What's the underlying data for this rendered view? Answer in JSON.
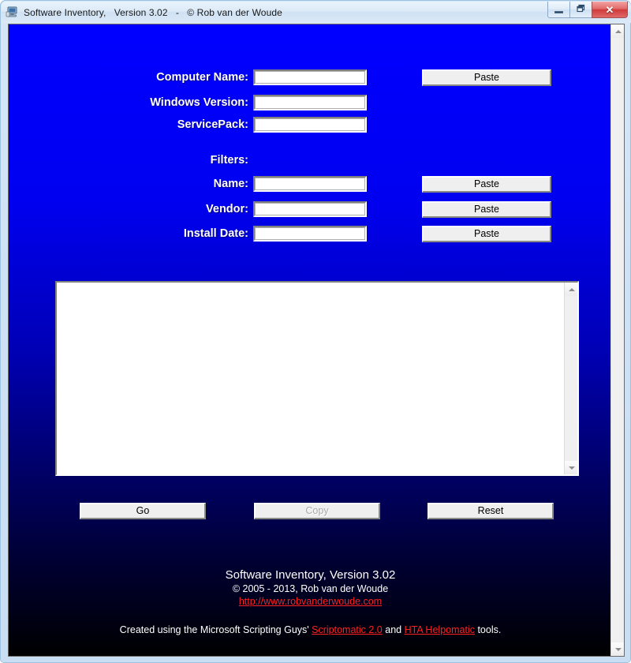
{
  "window": {
    "title": "Software Inventory,   Version 3.02   -   © Rob van der Woude",
    "icon": "computer-monitor-icon",
    "buttons": {
      "minimize": "–",
      "restore": "❐",
      "close": "✕"
    }
  },
  "form": {
    "fields": [
      {
        "label": "Computer Name:",
        "value": "",
        "paste_label": "Paste",
        "has_paste": true,
        "focused": true
      },
      {
        "label": "Windows Version:",
        "value": "",
        "paste_label": "Paste",
        "has_paste": false,
        "focused": false
      },
      {
        "label": "ServicePack:",
        "value": "",
        "paste_label": "Paste",
        "has_paste": false,
        "focused": false
      }
    ],
    "filters_heading": "Filters:",
    "filters": [
      {
        "label": "Name:",
        "value": "",
        "paste_label": "Paste"
      },
      {
        "label": "Vendor:",
        "value": "",
        "paste_label": "Paste"
      },
      {
        "label": "Install Date:",
        "value": "",
        "paste_label": "Paste"
      }
    ]
  },
  "output": {
    "value": "",
    "placeholder": "",
    "scrollbar": {
      "up": "up-arrow-icon",
      "down": "down-arrow-icon"
    }
  },
  "actions": {
    "go": "Go",
    "copy": "Copy",
    "copy_disabled": true,
    "reset": "Reset"
  },
  "footer": {
    "line1": "Software Inventory, Version 3.02",
    "line2": "© 2005 - 2013, Rob van der Woude",
    "link_site": "http://www.robvanderwoude.com",
    "credit_prefix": "Created using the Microsoft Scripting Guys' ",
    "credit_link1": "Scriptomatic 2.0",
    "credit_middle": " and ",
    "credit_link2": "HTA Helpomatic",
    "credit_suffix": " tools."
  },
  "colors": {
    "background_top": "#0000ff",
    "background_bottom": "#000000",
    "link": "#ff2020",
    "label_text": "#ffffff",
    "button_face": "#efefef",
    "close_button": "#cf3a3a"
  }
}
